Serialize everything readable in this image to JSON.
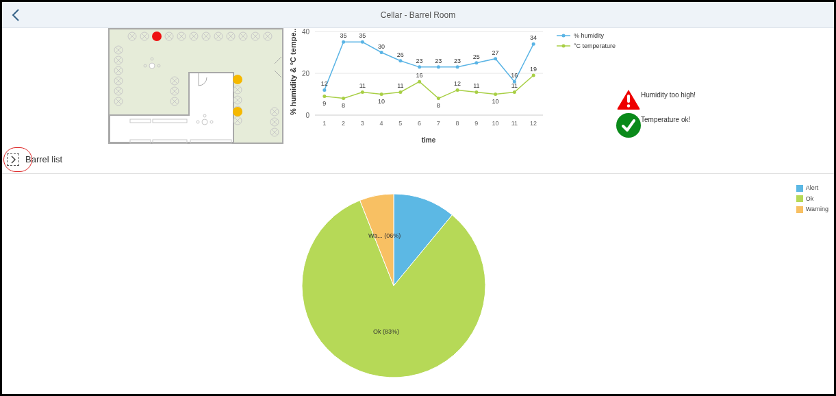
{
  "header": {
    "title": "Cellar - Barrel Room"
  },
  "trend_chart": {
    "chart_data": {
      "type": "line",
      "xlabel": "time",
      "ylabel": "% humidity & °C tempe...",
      "x": [
        1,
        2,
        3,
        4,
        5,
        6,
        7,
        8,
        9,
        10,
        11,
        12
      ],
      "xlim": [
        0.5,
        12.5
      ],
      "ylim": [
        0,
        40
      ],
      "legend": true,
      "yticks": [
        0,
        20,
        40
      ],
      "xticks": [
        1,
        2,
        3,
        4,
        5,
        6,
        7,
        8,
        9,
        10,
        11,
        12
      ],
      "data_labels": true,
      "series": [
        {
          "name": "% humidity",
          "color": "#5ab4e5",
          "values": [
            12,
            35,
            35,
            30,
            26,
            23,
            23,
            23,
            25,
            27,
            16,
            34
          ]
        },
        {
          "name": "°C temperature",
          "color": "#a8cf45",
          "values": [
            9,
            8,
            11,
            10,
            11,
            16,
            8,
            12,
            11,
            10,
            11,
            19
          ]
        }
      ]
    }
  },
  "alerts": [
    {
      "kind": "warning",
      "text": "Humidity too high!"
    },
    {
      "kind": "ok",
      "text": "Temperature ok!"
    }
  ],
  "barrel_list": {
    "label": "Barrel list",
    "expanded": false
  },
  "status_chart": {
    "chart_data": {
      "type": "pie",
      "categories": [
        "Alert",
        "Ok",
        "Warning"
      ],
      "values": [
        11,
        83,
        6
      ],
      "value_labels": [
        null,
        "Ok (83%)",
        "Wa... (06%)"
      ],
      "colors": [
        "#5cb8e4",
        "#b6d957",
        "#f8c063"
      ]
    }
  }
}
